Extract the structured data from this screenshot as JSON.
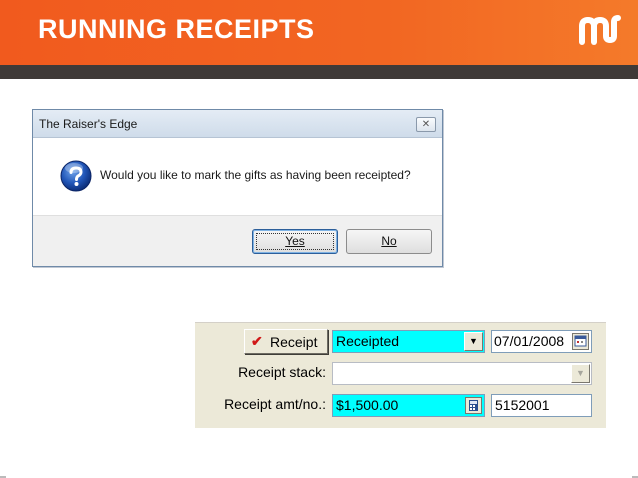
{
  "slide": {
    "title": "RUNNING RECEIPTS",
    "accent_color": "#f26622",
    "bar_color": "#3f3a38",
    "logo_icon": "mw-logo"
  },
  "dialog": {
    "title": "The Raiser's Edge",
    "close_label": "✕",
    "icon": "question-icon",
    "message": "Would you like to mark the gifts as having been receipted?",
    "yes_label": "Yes",
    "no_label": "No"
  },
  "receipt_panel": {
    "receipt_button_label": "Receipt",
    "receipt_check_icon": "checkmark-icon",
    "status_value": "Receipted",
    "status_color": "#00ffff",
    "date_value": "07/01/2008",
    "date_icon": "calendar-icon",
    "receipt_stack_label": "Receipt stack:",
    "receipt_stack_value": "",
    "amount_label": "Receipt amt/no.:",
    "amount_value": "$1,500.00",
    "amount_icon": "calculator-icon",
    "receipt_number_value": "5152001"
  }
}
